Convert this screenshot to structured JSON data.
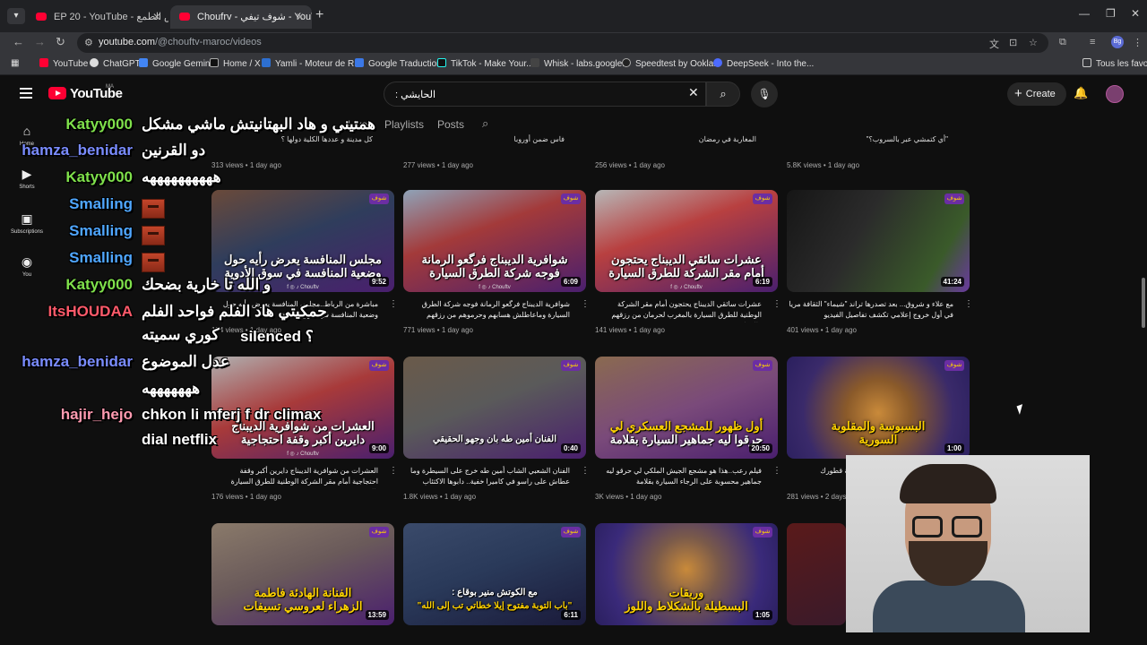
{
  "browser": {
    "tabs": [
      {
        "label": "EP 20 - YouTube - عش الطمع"
      },
      {
        "label": "Choufrv - شوف تيفي - YouTube"
      }
    ],
    "url": {
      "host": "youtube.com",
      "path": "/@chouftv-maroc/videos"
    },
    "bookmarks": [
      "YouTube",
      "ChatGPT",
      "Google Gemini",
      "Home / X",
      "Yamli - Moteur de R...",
      "Google Traduction",
      "TikTok - Make Your...",
      "Whisk - labs.google...",
      "Speedtest by Ookla...",
      "DeepSeek - Into the..."
    ],
    "all_bookmarks": "Tous les favoris",
    "profile_initials": "Bg"
  },
  "youtube": {
    "logo_text": "YouTube",
    "region": "MA",
    "search_value": "الحايشي :",
    "create_label": "Create",
    "guide": [
      {
        "icon": "home-icon",
        "label": "Home"
      },
      {
        "icon": "shorts-icon",
        "label": "Shorts"
      },
      {
        "icon": "subscriptions-icon",
        "label": "Subscriptions"
      },
      {
        "icon": "you-icon",
        "label": "You"
      }
    ],
    "channel_tabs": [
      "Live",
      "Playlists",
      "Posts"
    ]
  },
  "top_row": [
    {
      "title": "كل مدينة و عددها الكلية دولها ؟",
      "meta": "313 views • 1 day ago"
    },
    {
      "title": "فاس ضمن أوروبا",
      "meta": "277 views • 1 day ago"
    },
    {
      "title": "المغاربة في رمضان",
      "meta": "256 views • 1 day ago"
    },
    {
      "title": "\"أي كتمشي عبر بالسروب؟\"",
      "meta": "5.8K views • 1 day ago"
    }
  ],
  "videos": [
    {
      "caption_a": "مجلس المنافسة يعرض رأيه حول",
      "caption_b": "وضعية المنافسة في سوق الأدوية",
      "duration": "9:52",
      "title": "مباشرة من الرباط..مجلس المنافسة يعرض رأيه حول وضعية المنافسة في سوق الأدوية",
      "meta": "174 views • 1 day ago"
    },
    {
      "caption_a": "شوافرية الديبناج فرگعو الرمانة",
      "caption_b": "فوجه شركة الطرق السيارة",
      "duration": "6:09",
      "title": "شوافرية الديبناج فرگعو الرمانة فوجه شركة الطرق السيارة وماعاطلش هسابهم وحرموهم من رزقهم",
      "meta": "771 views • 1 day ago"
    },
    {
      "caption_a": "عشرات سائقي الديبناج يحتجون",
      "caption_b": "أمام مقر الشركة للطرق السيارة",
      "duration": "6:19",
      "title": "عشرات سائقي الديبناج يحتجون أمام مقر الشركة الوطنية للطرق السيارة بالمغرب لحرمان من رزقهم فالمواقع",
      "meta": "141 views • 1 day ago"
    },
    {
      "caption_a": "",
      "caption_b": "",
      "duration": "41:24",
      "title": "مع علاء و شروق... بعد تصدرها تراند \"شيماء\" الثقافة مريا في أول خروج إعلامي تكشف تفاصيل الفيديو",
      "meta": "401 views • 1 day ago"
    },
    {
      "caption_a": "العشرات من شوافرية الديبناج",
      "caption_b": "دايرين أكبر وقفة احتجاجية",
      "duration": "9:00",
      "title": "العشرات من شوافرية الديبناج دايرين أكبر وقفة احتجاجية أمام مقر الشركة الوطنية للطرق السيارة بالمغرب",
      "meta": "176 views • 1 day ago"
    },
    {
      "caption_a": "الفنان أمين طه بان وجهو الحقيقي",
      "caption_b": "",
      "duration": "0:40",
      "title": "الفنان الشعبي الشاب أمين طه خرج على السيطرة وما عطاش على راسو في كاميرا خفية.. دابوها الاكتئاب",
      "meta": "1.8K views • 1 day ago"
    },
    {
      "caption_a": "أول ظهور للمشجع العسكري لي",
      "caption_b": "حرقوا ليه جماهير السيارة بقلامة",
      "duration": "20:50",
      "title": "فيلم رعب..هذا هو مشجع الجيش الملكي لي حرقو ليه جماهير محسوبة على الرجاء السيارة بقلامة",
      "meta": "3K views • 1 day ago"
    },
    {
      "caption_a": "البسبوسة والمقلوبة",
      "caption_b": "السورية",
      "duration": "1:00",
      "title": "البسبوسة والمقلوبة السورية.. بالنكهة قطورك",
      "meta": "281 views • 2 days ago"
    },
    {
      "caption_a": "الفنانة الهادئة فاطمة",
      "caption_b": "الزهراء لعروسي تسيفات",
      "duration": "13:59",
      "title": "",
      "meta": ""
    },
    {
      "caption_a": "مع الكوتش منير بوقاع :",
      "caption_b": "\"باب التوبة مفتوح إيلا خطاتي تب إلى الله\"",
      "duration": "6:11",
      "title": "",
      "meta": ""
    },
    {
      "caption_a": "وريقات",
      "caption_b": "البسطيلة بالشكلاط واللوز",
      "duration": "1:05",
      "title": "",
      "meta": ""
    }
  ],
  "chat": [
    {
      "user": "Katyy000",
      "color": "#7fe04b",
      "message": "همتيني و هاد البهتانيتش ماشي مشكل"
    },
    {
      "user": "hamza_benidar",
      "color": "#7a8cff",
      "message": "دو القرنين"
    },
    {
      "user": "Katyy000",
      "color": "#7fe04b",
      "message": "ههههههههههه"
    },
    {
      "user": "Smalling",
      "color": "#4fa6ff",
      "message": ""
    },
    {
      "user": "Smalling",
      "color": "#4fa6ff",
      "message": ""
    },
    {
      "user": "Smalling",
      "color": "#4fa6ff",
      "message": ""
    },
    {
      "user": "Katyy000",
      "color": "#7fe04b",
      "message": "و الله تا خارية بضحك"
    },
    {
      "user": "ItsHOUDAA",
      "color": "#ff5a6a",
      "message": "حمكيتي هاد الفلم فواحد الفلم"
    },
    {
      "user": "",
      "color": "#ffffff",
      "message": "كوري سميته"
    },
    {
      "user": "",
      "color": "#ffffff",
      "message": "silenced ؟"
    },
    {
      "user": "hamza_benidar",
      "color": "#7a8cff",
      "message": "عدل الموضوع"
    },
    {
      "user": "",
      "color": "#ffffff",
      "message": "هههههههه"
    },
    {
      "user": "hajir_hejo",
      "color": "#ff9ab0",
      "message": "chkon li mferj f dr climax"
    },
    {
      "user": "",
      "color": "#ffffff",
      "message": "dial netflix"
    }
  ]
}
